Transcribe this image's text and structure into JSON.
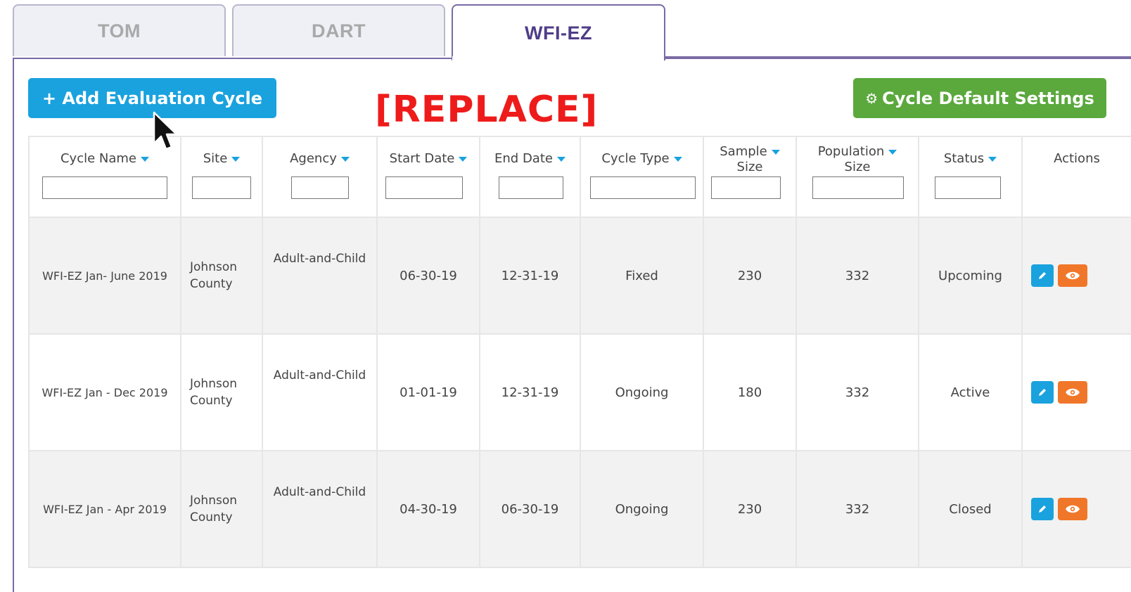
{
  "tabs": [
    {
      "label": "TOM",
      "active": false
    },
    {
      "label": "DART",
      "active": false
    },
    {
      "label": "WFI-EZ",
      "active": true
    }
  ],
  "toolbar": {
    "add_label": "+ Add Evaluation Cycle",
    "settings_label": "Cycle Default Settings",
    "settings_icon": "gear-icon",
    "overlay_text": "[REPLACE]"
  },
  "table": {
    "headers": {
      "cycle_name": "Cycle Name",
      "site": "Site",
      "agency": "Agency",
      "start_date": "Start Date",
      "end_date": "End Date",
      "cycle_type": "Cycle Type",
      "sample_size_1": "Sample",
      "sample_size_2": "Size",
      "population_size_1": "Population",
      "population_size_2": "Size",
      "status": "Status",
      "actions": "Actions"
    },
    "rows": [
      {
        "cycle_name": "WFI-EZ Jan- June 2019",
        "site_1": "Johnson",
        "site_2": "County",
        "agency": "Adult-and-Child",
        "start_date": "06-30-19",
        "end_date": "12-31-19",
        "cycle_type": "Fixed",
        "sample_size": "230",
        "population_size": "332",
        "status": "Upcoming"
      },
      {
        "cycle_name": "WFI-EZ Jan - Dec 2019",
        "site_1": "Johnson",
        "site_2": "County",
        "agency": "Adult-and-Child",
        "start_date": "01-01-19",
        "end_date": "12-31-19",
        "cycle_type": "Ongoing",
        "sample_size": "180",
        "population_size": "332",
        "status": "Active"
      },
      {
        "cycle_name": "WFI-EZ Jan - Apr 2019",
        "site_1": "Johnson",
        "site_2": "County",
        "agency": "Adult-and-Child",
        "start_date": "04-30-19",
        "end_date": "06-30-19",
        "cycle_type": "Ongoing",
        "sample_size": "230",
        "population_size": "332",
        "status": "Closed"
      }
    ]
  },
  "colors": {
    "primary_blue": "#1aa2de",
    "green": "#5ba83d",
    "orange": "#f0772a",
    "tab_active_text": "#4f3d87",
    "overlay_red": "#ee1b1b"
  }
}
